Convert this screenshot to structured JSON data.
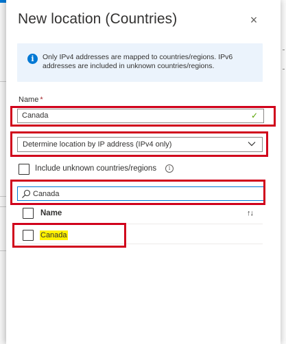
{
  "panel": {
    "title": "New location (Countries)",
    "close_glyph": "×",
    "info": {
      "icon": "info-icon",
      "icon_glyph": "i",
      "text": "Only IPv4 addresses are mapped to countries/regions. IPv6 addresses are included in unknown countries/regions."
    },
    "name_field": {
      "label": "Name",
      "required_mark": "*",
      "value": "Canada",
      "valid_glyph": "✓"
    },
    "location_method": {
      "selected": "Determine location by IP address (IPv4 only)"
    },
    "include_unknown": {
      "label": "Include unknown countries/regions",
      "checked": false,
      "info_glyph": "i"
    },
    "search": {
      "value": "Canada"
    },
    "list": {
      "header": "Name",
      "sort_glyph": "↑↓",
      "rows": [
        {
          "label": "Canada",
          "checked": false,
          "highlighted": true
        }
      ]
    }
  },
  "colors": {
    "accent": "#0078d4",
    "annotation_red": "#d0021b",
    "highlight_yellow": "#fff100",
    "info_bg": "#ebf3fc"
  }
}
